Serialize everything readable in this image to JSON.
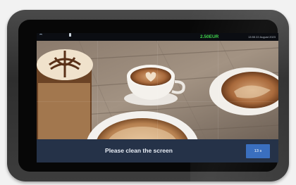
{
  "status_bar": {
    "price": "2.50EUR",
    "datetime": "13:55 22 August 2023"
  },
  "message": {
    "text": "Please clean the screen",
    "countdown": "13 s"
  },
  "colors": {
    "price_green": "#3fd34c",
    "message_bar": "#253248",
    "timer_button": "#3a6fbf"
  },
  "icons": [
    "wifi-icon",
    "person-icon"
  ]
}
